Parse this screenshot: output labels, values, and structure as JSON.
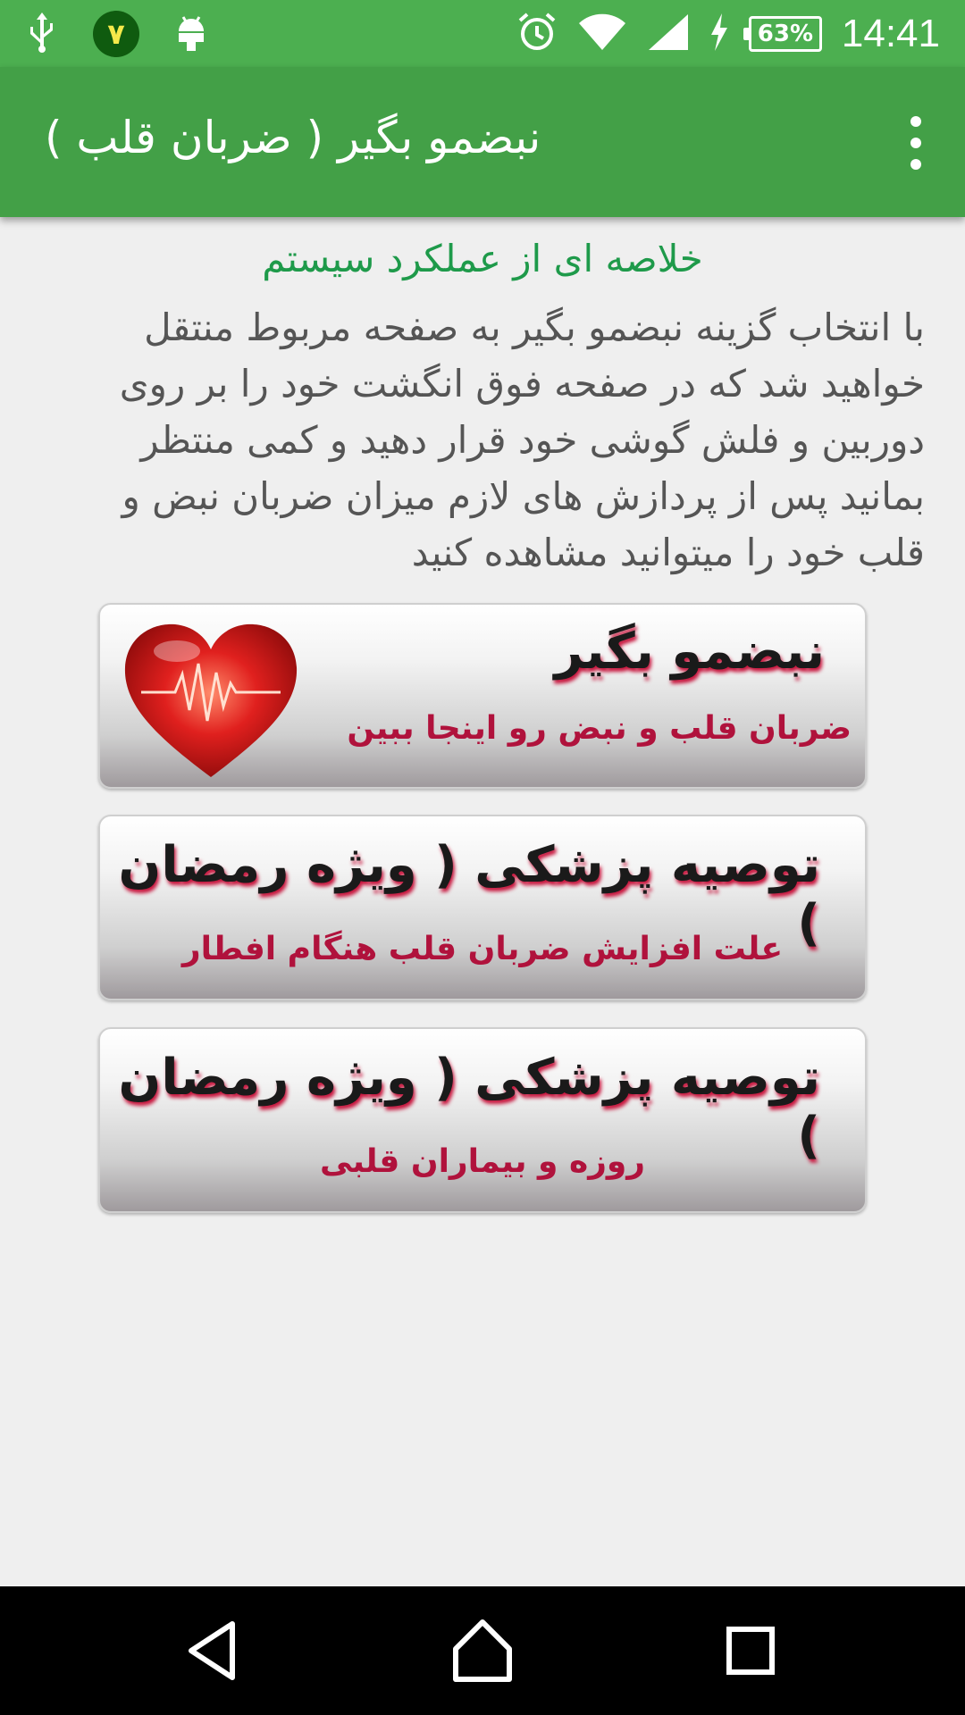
{
  "status_bar": {
    "badge": "٧",
    "battery": "63%",
    "time": "14:41",
    "icons": [
      "usb-icon",
      "android-debug-icon",
      "alarm-icon",
      "wifi-icon",
      "signal-icon",
      "charging-icon"
    ]
  },
  "app_bar": {
    "title": "نبضمو بگیر ( ضربان قلب )"
  },
  "summary": {
    "title": "خلاصه ای از عملکرد سیستم",
    "body": "با انتخاب گزینه نبضمو بگیر به صفحه مربوط منتقل خواهید شد که در صفحه فوق انگشت خود را بر روی دوربین و فلش گوشی خود قرار دهید و کمی منتظر بمانید پس از پردازش های لازم میزان ضربان نبض و قلب خود را میتوانید مشاهده کنید"
  },
  "cards": [
    {
      "title": "نبضمو بگیر",
      "subtitle": "ضربان قلب و نبض رو اینجا ببین"
    },
    {
      "title": "توصیه پزشکی ( ویژه رمضان )",
      "subtitle": "علت افزایش ضربان قلب هنگام افطار"
    },
    {
      "title": "توصیه پزشکی ( ویژه رمضان )",
      "subtitle": "روزه و بیماران قلبی"
    }
  ],
  "colors": {
    "status_bar": "#4caf50",
    "app_bar": "#43a047",
    "summary_title": "#1e9a4a",
    "card_subtitle": "#b0123c"
  }
}
